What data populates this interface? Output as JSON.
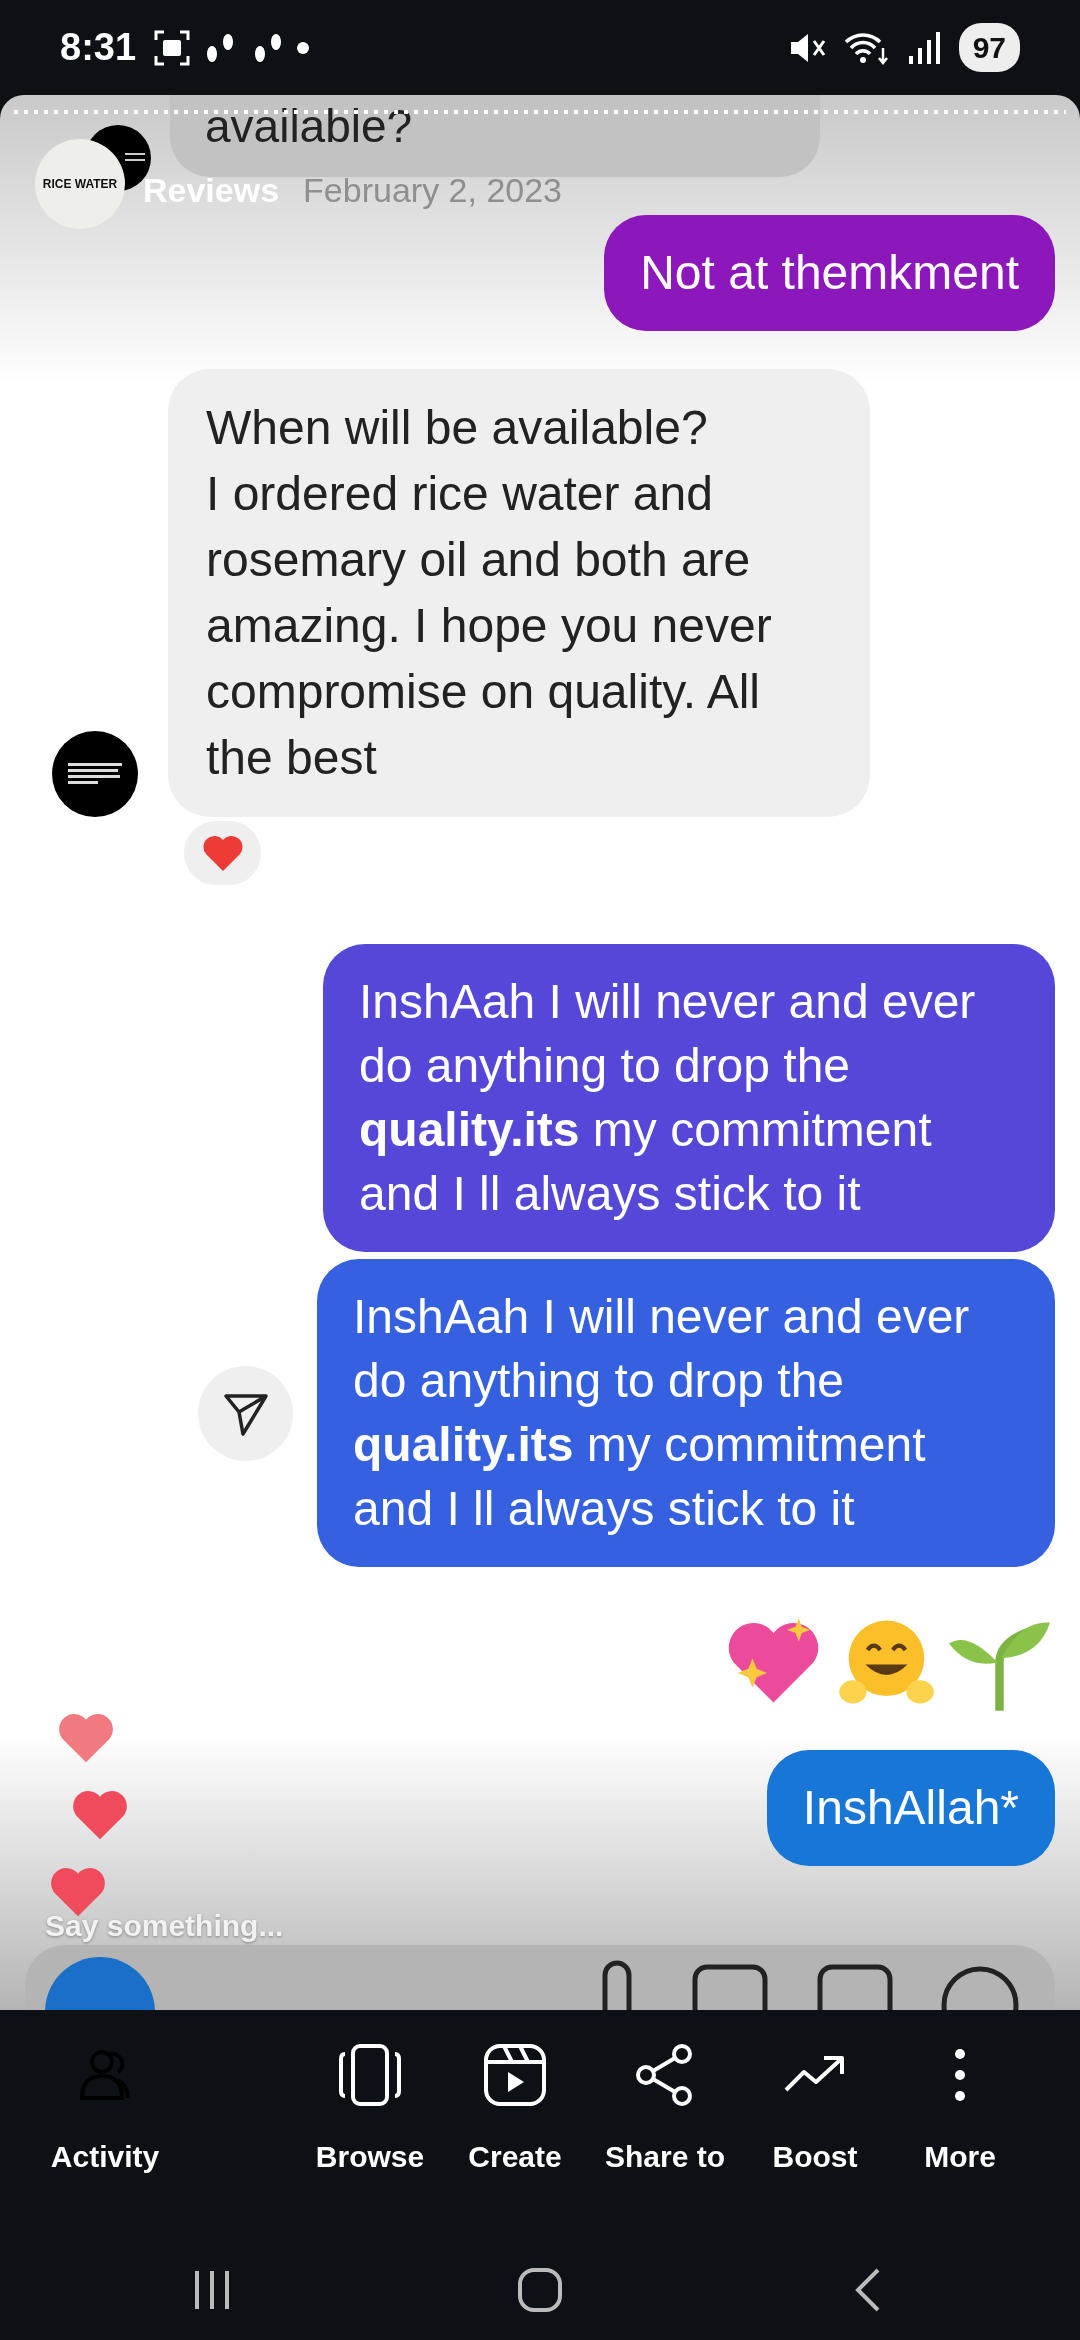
{
  "status_bar": {
    "time": "8:31",
    "battery": "97"
  },
  "story_header": {
    "avatar_label": "RICE WATER",
    "title": "Reviews",
    "date": "February 2, 2023"
  },
  "messages": [
    {
      "kind": "received_cut",
      "text": "available?"
    },
    {
      "kind": "sent",
      "text": "Not at themkment",
      "color": "#8c17bb",
      "share": false
    },
    {
      "kind": "received",
      "text": "When will be available?\nI ordered rice water and rosemary oil and both are amazing. I hope you never compromise on quality. All the best",
      "reaction": true
    },
    {
      "kind": "sent",
      "text": "InshAah I will never and ever do anything to drop the **quality.its** my commitment and I ll always stick to it",
      "color": "#5548d8",
      "share": false
    },
    {
      "kind": "sent",
      "text": "InshAah I will never and ever do anything to drop the **quality.its** my commitment and I ll always stick to it",
      "color": "#3561e0",
      "share": true
    },
    {
      "kind": "emoji_row"
    },
    {
      "kind": "sent",
      "text": "InshAllah*",
      "color": "#1877d6",
      "share": false
    }
  ],
  "comment_prompt": "Say something...",
  "action_bar": [
    {
      "kind": "activity",
      "label": "Activity"
    },
    {
      "kind": "browse",
      "label": "Browse"
    },
    {
      "kind": "create",
      "label": "Create"
    },
    {
      "kind": "share",
      "label": "Share to"
    },
    {
      "kind": "boost",
      "label": "Boost"
    },
    {
      "kind": "more",
      "label": "More"
    }
  ]
}
